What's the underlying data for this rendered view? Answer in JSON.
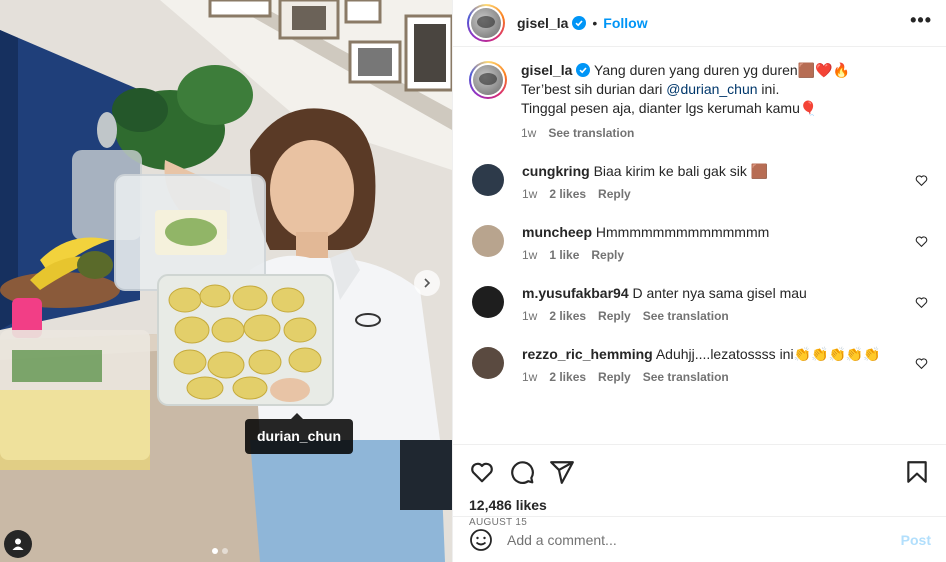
{
  "post": {
    "username": "gisel_la",
    "follow_label": "Follow",
    "more_label": "•••",
    "separator": "•",
    "photo_tag": "durian_chun",
    "carousel": {
      "count": 2,
      "active": 1
    }
  },
  "caption": {
    "username": "gisel_la",
    "line1": "Yang duren yang duren yg duren🟫❤️🔥",
    "line2_before": "Ter’best sih durian dari ",
    "line2_mention": "@durian_chun",
    "line2_after": " ini.",
    "line3": "Tinggal pesen aja, dianter lgs kerumah kamu🎈",
    "time": "1w",
    "translate": "See translation"
  },
  "comments": [
    {
      "username": "cungkring",
      "text": "Biaa kirim ke bali gak sik 🟫",
      "time": "1w",
      "likes": "2 likes",
      "reply": "Reply",
      "translate": "",
      "avatar_color": "#2d3a4a"
    },
    {
      "username": "muncheep",
      "text": "Hmmmmmmmmmmmmmm",
      "time": "1w",
      "likes": "1 like",
      "reply": "Reply",
      "translate": "",
      "avatar_color": "#b8a48e"
    },
    {
      "username": "m.yusufakbar94",
      "text": "D anter nya sama gisel mau",
      "time": "1w",
      "likes": "2 likes",
      "reply": "Reply",
      "translate": "See translation",
      "avatar_color": "#1e1e1e"
    },
    {
      "username": "rezzo_ric_hemming",
      "text": "Aduhjj....lezatossss ini👏👏👏👏👏",
      "time": "1w",
      "likes": "2 likes",
      "reply": "Reply",
      "translate": "See translation",
      "avatar_color": "#5a4a40"
    }
  ],
  "stats": {
    "likes": "12,486 likes",
    "date": "AUGUST 15"
  },
  "add_comment": {
    "placeholder": "Add a comment...",
    "post_label": "Post"
  },
  "colors": {
    "accent": "#0095f6",
    "text": "#262626",
    "muted": "#737373",
    "mention": "#00376b",
    "post_disabled": "#b2dffc"
  },
  "icons": [
    "heart-icon",
    "comment-icon",
    "share-icon",
    "bookmark-icon",
    "emoji-icon",
    "verified-badge-icon",
    "more-options-icon",
    "user-tag-icon",
    "chevron-right-icon"
  ]
}
